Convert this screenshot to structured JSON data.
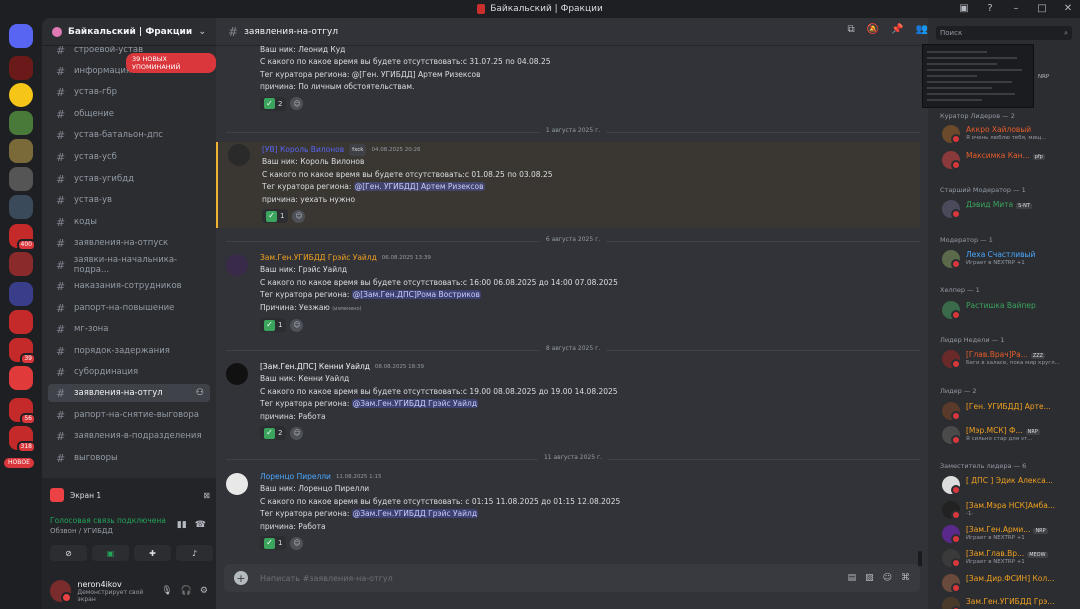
{
  "window": {
    "title": "Байкальский | Фракции"
  },
  "rail": {
    "new_label": "НОВОЕ",
    "badges": [
      "400",
      "39",
      "56",
      "318"
    ]
  },
  "sidebar": {
    "guild_name": "Байкальский | Фракции",
    "mentions_label": "39 НОВЫХ УПОМИНАНИЙ",
    "channels": [
      "строевой-устав",
      "информация",
      "устав-гбр",
      "общение",
      "устав-батальон-дпс",
      "устав-усб",
      "устав-угибдд",
      "устав-ув",
      "коды",
      "заявления-на-отпуск",
      "заявки-на-начальника-подра...",
      "наказания-сотрудников",
      "рапорт-на-повышение",
      "мг-зона",
      "порядок-задержания",
      "субординация",
      "заявления-на-отгул",
      "рапорт-на-снятие-выговора",
      "заявления-в-подразделения",
      "выговоры"
    ]
  },
  "panel": {
    "screen_label": "Экран 1",
    "voice_status": "Голосовая связь подключена",
    "voice_channel": "Обзвон / УГИБДД",
    "username": "neron4ikov",
    "user_status": "Демонстрирует свой экран"
  },
  "chat": {
    "channel": "заявления-на-отгул",
    "composer_placeholder": "Написать #заявления-на-отгул",
    "dividers": [
      "1 августа 2025 г.",
      "6 августа 2025 г.",
      "8 августа 2025 г.",
      "11 августа 2025 г."
    ],
    "messages": [
      {
        "author": "",
        "time": "",
        "tag": "",
        "lines": [
          "Ваш ник: Леонид Куд",
          "С какого по какое время вы будете отсутствовать:с 31.07.25 по 04.08.25",
          "Тег куратора региона: @[Ген. УГИБДД] Артем Ризексов",
          "причина: По личным обстоятельствам."
        ],
        "reaction_count": "2"
      },
      {
        "author": "[УВ] Король Вилонов",
        "time": "04.08.2025 20:26",
        "tag": "fxck",
        "lines": [
          "Ваш ник: Король Вилонов",
          "С какого по какое время вы будете отсутствовать:с 01.08.25 по 03.08.25"
        ],
        "mention_prefix": "Тег куратора региона: ",
        "mention": "@[Ген. УГИБДД] Артем Ризексов",
        "reason": "причина: уехать нужно",
        "reaction_count": "1"
      },
      {
        "author": "Зам.Ген.УГИБДД Грэйс Уайлд",
        "time": "06.08.2025 13:39",
        "lines": [
          "Ваш ник: Грэйс Уайлд",
          "С какого по какое время вы будете отсутствовать:с 16:00 06.08.2025 до 14:00 07.08.2025"
        ],
        "mention_prefix": "Тег куратора региона: ",
        "mention": "@[Зам.Ген.ДПС]Рома Востриков",
        "reason": "Причина: Уезжаю",
        "edited": "(изменено)",
        "reaction_count": "1"
      },
      {
        "author": "[Зам.Ген.ДПС] Кенни Уайлд",
        "time": "08.08.2025 18:39",
        "lines": [
          "Ваш ник: Кенни Уайлд",
          "С какого по какое время вы будете отсутствовать:с 19.00 08.08.2025 до 19.00 14.08.2025"
        ],
        "mention_prefix": "Тег куратора региона: ",
        "mention": "@Зам.Ген.УГИБДД Грэйс Уайлд",
        "reason": "причина: Работа",
        "reaction_count": "2"
      },
      {
        "author": "Лоренцо Пирелли",
        "time": "11.08.2025 1:15",
        "lines": [
          "Ваш ник: Лоренцо Пирелли",
          "С какого по какое время вы будете отсутствовать: с 01:15 11.08.2025 до 01:15 12.08.2025"
        ],
        "mention_prefix": "Тег куратора региона: ",
        "mention": "@Зам.Ген.УГИБДД Грэйс Уайлд",
        "reason": "причина: Работа",
        "reaction_count": "1"
      }
    ]
  },
  "members": {
    "search_placeholder": "Поиск",
    "preview_tag": "NRP",
    "groups": [
      {
        "title": "Куратор Лидеров — 2",
        "items": [
          {
            "name": "Аккро Хайловый",
            "tag": "",
            "status": "Я очень люблю тебя, мищ...",
            "color": "#e85c2a"
          },
          {
            "name": "Максимка Кан...",
            "tag": "pfp",
            "status": "",
            "color": "#e85c2a"
          }
        ]
      },
      {
        "title": "Старший Модератор — 1",
        "items": [
          {
            "name": "Дэвид Мита",
            "tag": "S-NT",
            "status": "",
            "color": "#3ba55d"
          }
        ]
      },
      {
        "title": "Модератор — 1",
        "items": [
          {
            "name": "Леха Счастливый",
            "tag": "",
            "status": "Играет в NEXTRP +1",
            "color": "#4aa8ff"
          }
        ]
      },
      {
        "title": "Хелпер — 1",
        "items": [
          {
            "name": "Растишка Вайпер",
            "tag": "",
            "status": "",
            "color": "#3ba55d"
          }
        ]
      },
      {
        "title": "Лидер Недели — 1",
        "items": [
          {
            "name": "[Глав.Врач]Ра...",
            "tag": "ZZZ",
            "status": "Беги в халасе, пока мир кругл...",
            "color": "#e85c2a"
          }
        ]
      },
      {
        "title": "Лидер — 2",
        "items": [
          {
            "name": "[Ген. УГИБДД] Арте...",
            "tag": "",
            "status": "",
            "color": "#f0a020"
          },
          {
            "name": "[Мэр.МСК] Ф...",
            "tag": "NRP",
            "status": "Я сильно стар для эт...",
            "color": "#f0a020"
          }
        ]
      },
      {
        "title": "Заместитель лидера — 6",
        "items": [
          {
            "name": "[ ДПС ] Эдик Алекса...",
            "tag": "",
            "status": "",
            "color": "#f0a020"
          },
          {
            "name": "[Зам.Мэра НСК]Амба...",
            "tag": "",
            "status": "-1-",
            "color": "#f0a020"
          },
          {
            "name": "[Зам.Ген.Арми...",
            "tag": "NRP",
            "status": "Играет в NEXTRP +1",
            "color": "#f0a020"
          },
          {
            "name": "[Зам.Глав.Вр...",
            "tag": "MEOW",
            "status": "Играет в NEXTRP +1",
            "color": "#f0a020"
          },
          {
            "name": "[Зам.Дир.ФСИН] Кол...",
            "tag": "",
            "status": "",
            "color": "#f0a020"
          },
          {
            "name": "Зам.Ген.УГИБДД Грэ...",
            "tag": "",
            "status": "",
            "color": "#f0a020"
          }
        ]
      }
    ]
  }
}
